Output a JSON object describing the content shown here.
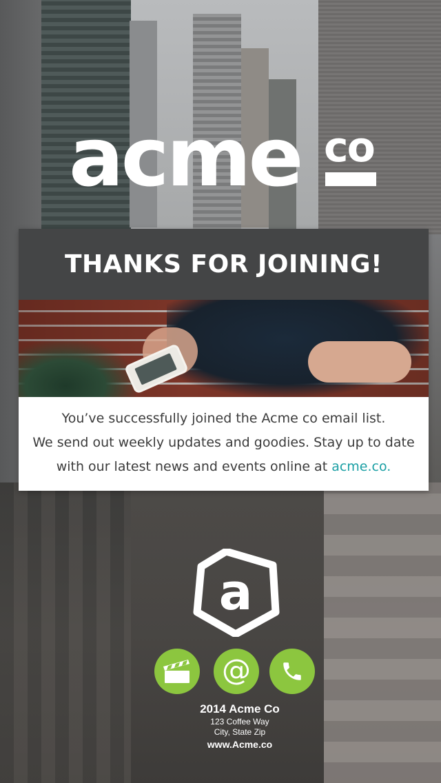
{
  "brand": {
    "logo_main": "acme",
    "logo_suffix": "co"
  },
  "card": {
    "title": "THANKS FOR JOINING!",
    "body_line1": "You’ve successfully joined the Acme co email list.",
    "body_line2": "We send out weekly updates and goodies. Stay up to date",
    "body_line3_prefix": "with our latest news and events online at ",
    "body_link": "acme.co."
  },
  "footer": {
    "logo_letter": "a",
    "social_icons": [
      "film-clapper-icon",
      "email-at-icon",
      "phone-icon"
    ],
    "company": "2014 Acme Co",
    "street": "123 Coffee Way",
    "city": "City, State Zip",
    "website": "www.Acme.co"
  },
  "colors": {
    "header_bg": "#444546",
    "accent_green": "#8cc63f",
    "link_teal": "#1a9fa4"
  }
}
